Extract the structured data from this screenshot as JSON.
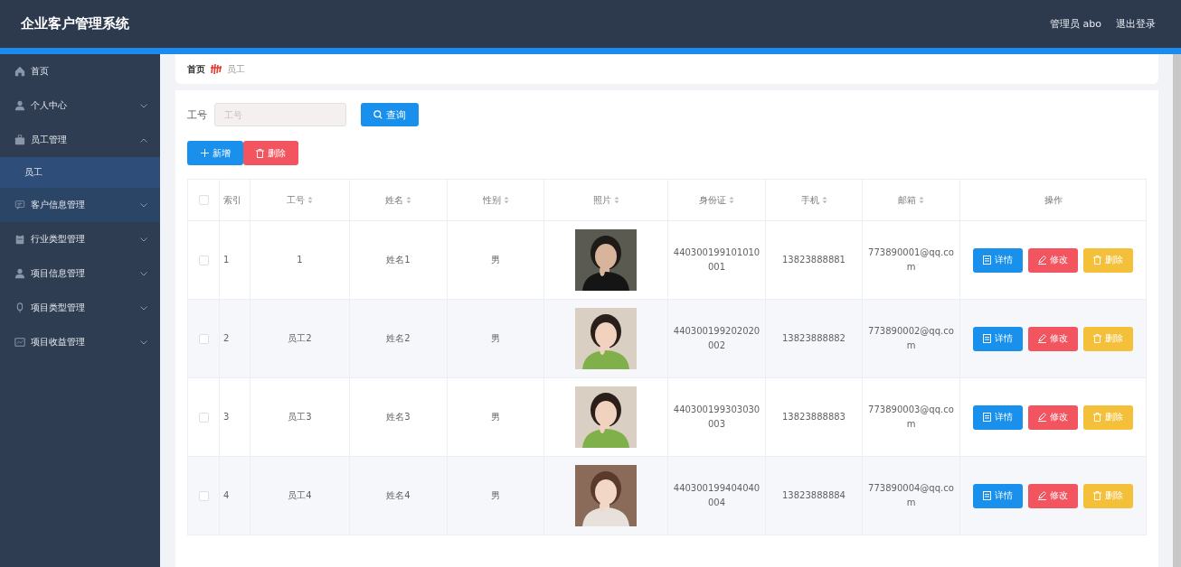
{
  "header": {
    "title": "企业客户管理系统",
    "user": "管理员 abo",
    "logout": "退出登录"
  },
  "sidebar": {
    "items": [
      {
        "label": "首页",
        "hovered": false
      },
      {
        "label": "个人中心",
        "hovered": false,
        "expanded": false
      },
      {
        "label": "员工管理",
        "hovered": false,
        "expanded": true,
        "children": [
          {
            "label": "员工",
            "selected": true
          }
        ]
      },
      {
        "label": "客户信息管理",
        "hovered": true,
        "expanded": false
      },
      {
        "label": "行业类型管理",
        "hovered": false,
        "expanded": false
      },
      {
        "label": "项目信息管理",
        "hovered": false,
        "expanded": false
      },
      {
        "label": "项目类型管理",
        "hovered": false,
        "expanded": false
      },
      {
        "label": "项目收益管理",
        "hovered": false,
        "expanded": false
      }
    ]
  },
  "breadcrumb": [
    "首页",
    "员工"
  ],
  "search": {
    "label": "工号",
    "placeholder": "工号",
    "button": "查询"
  },
  "actions": {
    "add": "新增",
    "delete": "删除"
  },
  "table": {
    "columns": [
      {
        "label": "索引",
        "sortable": false
      },
      {
        "label": "工号",
        "sortable": true
      },
      {
        "label": "姓名",
        "sortable": true
      },
      {
        "label": "性别",
        "sortable": true
      },
      {
        "label": "照片",
        "sortable": true
      },
      {
        "label": "身份证",
        "sortable": true
      },
      {
        "label": "手机",
        "sortable": true
      },
      {
        "label": "邮箱",
        "sortable": true
      },
      {
        "label": "操作",
        "sortable": false
      }
    ],
    "all_checked": false,
    "rows": [
      {
        "index": "1",
        "number": "1",
        "name": "姓名1",
        "gender": "男",
        "id_card": "440300199101010001",
        "phone": "13823888881",
        "email": "773890001@qq.com",
        "checked": false,
        "detail": "详情",
        "edit": "修改",
        "delete": "删除"
      },
      {
        "index": "2",
        "number": "员工2",
        "name": "姓名2",
        "gender": "男",
        "id_card": "440300199202020002",
        "phone": "13823888882",
        "email": "773890002@qq.com",
        "checked": false,
        "detail": "详情",
        "edit": "修改",
        "delete": "删除"
      },
      {
        "index": "3",
        "number": "员工3",
        "name": "姓名3",
        "gender": "男",
        "id_card": "440300199303030003",
        "phone": "13823888883",
        "email": "773890003@qq.com",
        "checked": false,
        "detail": "详情",
        "edit": "修改",
        "delete": "删除"
      },
      {
        "index": "4",
        "number": "员工4",
        "name": "姓名4",
        "gender": "男",
        "id_card": "440300199404040004",
        "phone": "13823888884",
        "email": "773890004@qq.com",
        "checked": false,
        "detail": "详情",
        "edit": "修改",
        "delete": "删除"
      }
    ]
  }
}
